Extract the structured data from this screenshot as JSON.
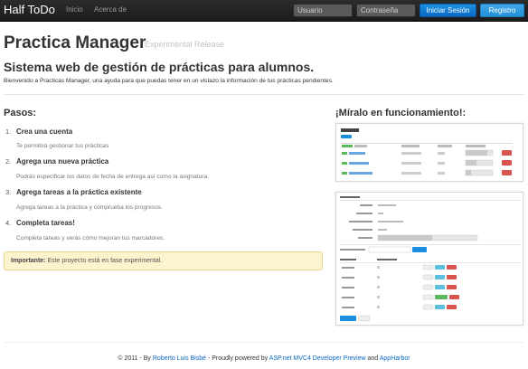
{
  "navbar": {
    "brand": "Half ToDo",
    "links": [
      "Inicio",
      "Acerca de"
    ],
    "username_placeholder": "Usuario",
    "password_placeholder": "Contraseña",
    "login_label": "Iniciar Sesión",
    "register_label": "Registro"
  },
  "header": {
    "title": "Practica Manager",
    "subtitle": "Experimental Release",
    "lead": "Sistema web de gestión de prácticas para alumnos.",
    "intro": "Bienvenido a Practicas Manager, una ayuda para que puedas tener en un vistazo la información de tus prácticas pendientes."
  },
  "steps": {
    "title": "Pasos:",
    "items": [
      {
        "num": "1.",
        "title": "Crea una cuenta",
        "desc": "Te permitirá gestionar tus prácticas"
      },
      {
        "num": "2.",
        "title": "Agrega una nueva práctica",
        "desc": "Podrás especificar los datos de fecha de entrega así como la asignatura."
      },
      {
        "num": "3.",
        "title": "Agrega tareas a la práctica existente",
        "desc": "Agrega tareas a la práctica y comprueba los progresos."
      },
      {
        "num": "4.",
        "title": "Completa tareas!",
        "desc": "Completa tareas y verás cómo mejoran tus marcadores."
      }
    ],
    "alert_strong": "Importante:",
    "alert_text": " Este proyecto está en fase experimental."
  },
  "demo": {
    "title": "¡Míralo en funcionamiento!:"
  },
  "footer": {
    "prefix": "© 2011 - By ",
    "author": "Roberto Luis Bisbé",
    "middle": " - Proudly powered by ",
    "tech": "ASP.net MVC4 Developer Preview",
    "and": " and ",
    "host": "AppHarbor"
  }
}
